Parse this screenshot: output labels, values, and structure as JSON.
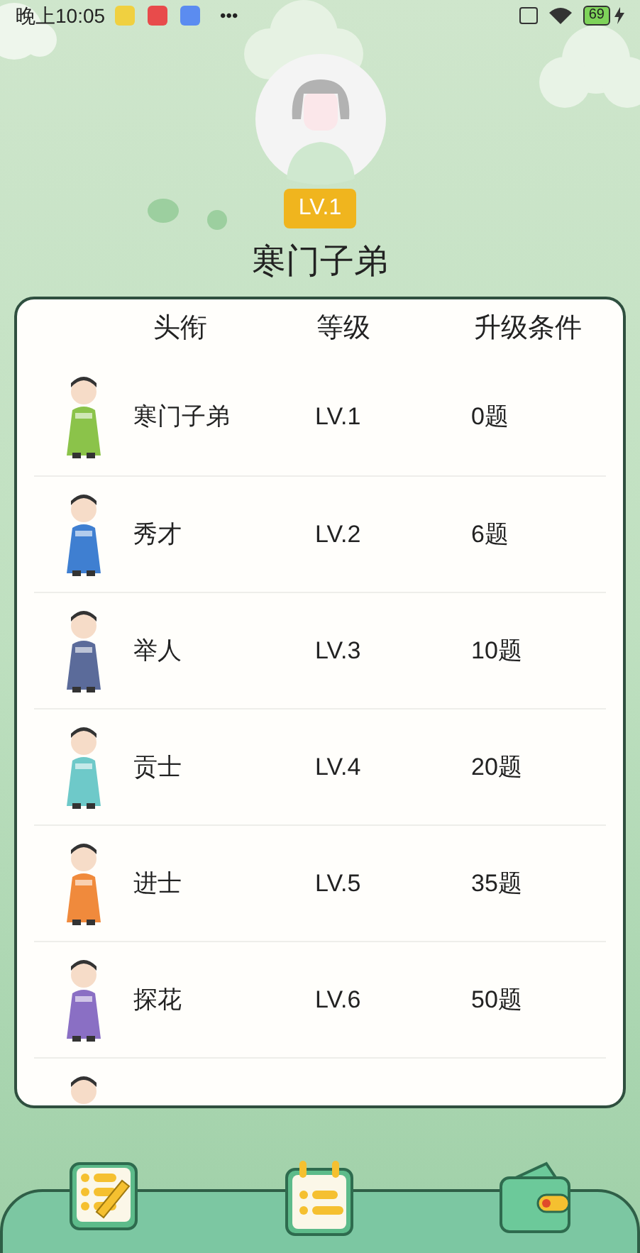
{
  "status_bar": {
    "time": "晚上10:05",
    "more": "•••",
    "battery": "69"
  },
  "profile": {
    "level_badge": "LV.1",
    "title": "寒门子弟"
  },
  "table": {
    "columns": [
      "头衔",
      "等级",
      "升级条件"
    ],
    "rows": [
      {
        "title": "寒门子弟",
        "level": "LV.1",
        "condition": "0题"
      },
      {
        "title": "秀才",
        "level": "LV.2",
        "condition": "6题"
      },
      {
        "title": "举人",
        "level": "LV.3",
        "condition": "10题"
      },
      {
        "title": "贡士",
        "level": "LV.4",
        "condition": "20题"
      },
      {
        "title": "进士",
        "level": "LV.5",
        "condition": "35题"
      },
      {
        "title": "探花",
        "level": "LV.6",
        "condition": "50题"
      }
    ]
  },
  "bottom_nav": [
    {
      "kind": "quiz"
    },
    {
      "kind": "level"
    },
    {
      "kind": "wallet"
    }
  ]
}
